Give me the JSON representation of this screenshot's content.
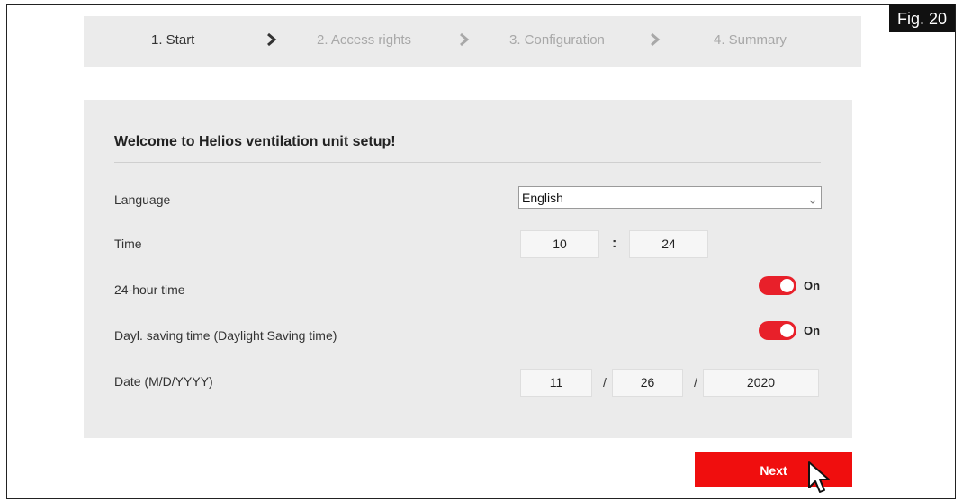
{
  "figure_label": "Fig. 20",
  "steps": [
    {
      "label": "1. Start",
      "active": true
    },
    {
      "label": "2. Access rights",
      "active": false
    },
    {
      "label": "3. Configuration",
      "active": false
    },
    {
      "label": "4. Summary",
      "active": false
    }
  ],
  "form": {
    "title": "Welcome to Helios ventilation unit setup!",
    "language": {
      "label": "Language",
      "value": "English"
    },
    "time": {
      "label": "Time",
      "hours": "10",
      "separator": ":",
      "minutes": "24"
    },
    "hour24": {
      "label": "24-hour time",
      "state": "On"
    },
    "dst": {
      "label": "Dayl. saving time (Daylight Saving time)",
      "state": "On"
    },
    "date": {
      "label": "Date (M/D/YYYY)",
      "month": "11",
      "day": "26",
      "year": "2020",
      "separator": "/"
    }
  },
  "next_label": "Next",
  "colors": {
    "accent": "#f00e0e",
    "panel": "#ebebeb"
  }
}
